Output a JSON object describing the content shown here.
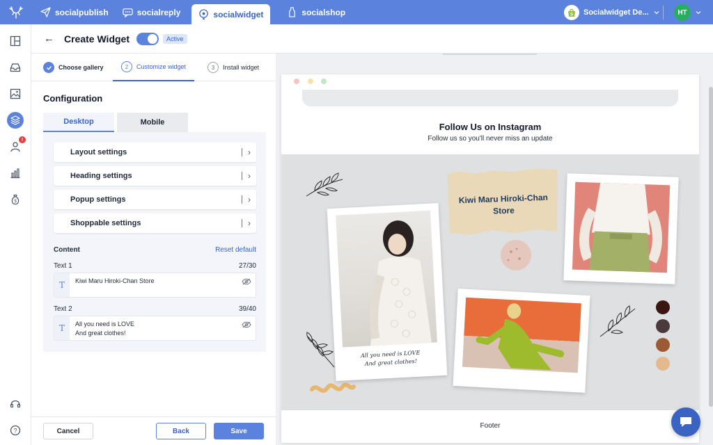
{
  "topbar": {
    "apps": [
      {
        "label": "socialpublish",
        "icon": "paper-plane-icon"
      },
      {
        "label": "socialreply",
        "icon": "chat-icon"
      },
      {
        "label": "socialwidget",
        "icon": "widget-icon",
        "active": true
      },
      {
        "label": "socialshop",
        "icon": "bottle-icon"
      }
    ],
    "store_name": "Socialwidget De...",
    "avatar_initials": "HT",
    "accent": "#5b82dc"
  },
  "rail": {
    "icons": [
      "dashboard-icon",
      "inbox-icon",
      "image-icon",
      "layers-icon",
      "user-icon",
      "analytics-icon",
      "money-bag-icon",
      "support-headset-icon",
      "help-icon"
    ],
    "notification_count": "!"
  },
  "header": {
    "title": "Create Widget",
    "status_badge": "Active"
  },
  "steps": [
    {
      "number": "1",
      "label": "Choose gallery",
      "state": "done"
    },
    {
      "number": "2",
      "label": "Customize widget",
      "state": "current"
    },
    {
      "number": "3",
      "label": "Install widget",
      "state": "todo"
    }
  ],
  "config": {
    "title": "Configuration",
    "tabs": [
      "Desktop",
      "Mobile"
    ],
    "settings": [
      "Layout settings",
      "Heading settings",
      "Popup settings",
      "Shoppable settings"
    ],
    "content_label": "Content",
    "reset_label": "Reset default",
    "fields": [
      {
        "label": "Text 1",
        "count": "27/30",
        "value": "Kiwi Maru Hiroki-Chan Store"
      },
      {
        "label": "Text 2",
        "count": "39/40",
        "value": "All you need is LOVE\nAnd great clothes!"
      }
    ]
  },
  "actions": {
    "cancel": "Cancel",
    "back": "Back",
    "save": "Save"
  },
  "preview": {
    "heading": "Follow Us on Instagram",
    "subheading": "Follow us so you'll never miss an update",
    "paper_text": "Kiwi Maru Hiroki-Chan\nStore",
    "caption": "All you need is LOVE\nAnd great clothes!",
    "footer": "Footer",
    "swatches": [
      "#3a1512",
      "#4a3a3c",
      "#9c5a34",
      "#e5b98e"
    ]
  }
}
